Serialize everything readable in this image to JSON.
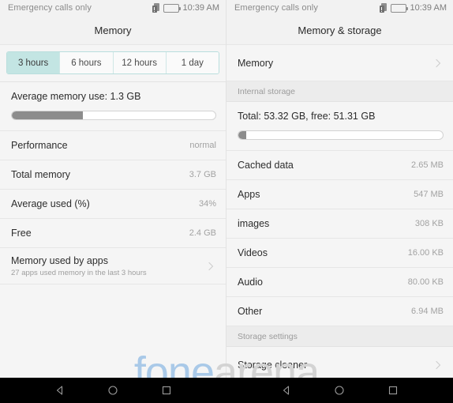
{
  "status_bar": {
    "carrier": "Emergency calls only",
    "clock": "10:39 AM",
    "sim_icon": "sim-card-icon",
    "battery_icon": "battery-icon"
  },
  "left_pane": {
    "title": "Memory",
    "tabs": [
      {
        "label": "3 hours",
        "active": true
      },
      {
        "label": "6 hours",
        "active": false
      },
      {
        "label": "12 hours",
        "active": false
      },
      {
        "label": "1 day",
        "active": false
      }
    ],
    "average_use": {
      "caption": "Average memory use: 1.3 GB",
      "fill_percent": "35"
    },
    "rows": [
      {
        "label": "Performance",
        "value": "normal"
      },
      {
        "label": "Total memory",
        "value": "3.7 GB"
      },
      {
        "label": "Average used (%)",
        "value": "34%"
      },
      {
        "label": "Free",
        "value": "2.4 GB"
      }
    ],
    "apps_row": {
      "label": "Memory used by apps",
      "sub": "27 apps used memory in the last 3 hours"
    }
  },
  "right_pane": {
    "title": "Memory & storage",
    "memory_row": {
      "label": "Memory"
    },
    "internal_storage_header": "Internal storage",
    "total_block": {
      "caption": "Total: 53.32 GB, free: 51.31 GB",
      "fill_percent": "4"
    },
    "storage_rows": [
      {
        "label": "Cached data",
        "value": "2.65 MB"
      },
      {
        "label": "Apps",
        "value": "547 MB"
      },
      {
        "label": "images",
        "value": "308 KB"
      },
      {
        "label": "Videos",
        "value": "16.00 KB"
      },
      {
        "label": "Audio",
        "value": "80.00 KB"
      },
      {
        "label": "Other",
        "value": "6.94 MB"
      }
    ],
    "storage_settings_header": "Storage settings",
    "cleaner_row": {
      "label": "Storage cleaner"
    }
  },
  "watermark": {
    "part1": "fone",
    "part2": "arena"
  },
  "nav_bar": {
    "back": "back-icon",
    "home": "home-icon",
    "recents": "recents-icon"
  },
  "colors": {
    "tab_active": "#c3e5e3",
    "tab_border": "#b9dedd",
    "progress_fill": "#8c8c8c",
    "surface": "#f5f5f5",
    "section_header": "#ececec"
  }
}
